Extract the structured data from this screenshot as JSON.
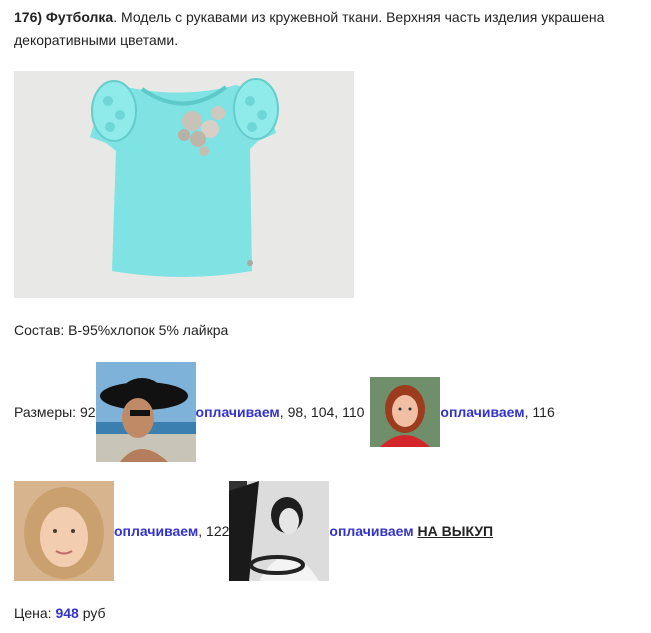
{
  "product": {
    "title": "176) Футболка",
    "description": ". Модель с рукавами из кружевной ткани. Верхняя часть изделия украшена декоративными цветами."
  },
  "composition": "Состав: В-95%хлопок 5% лайкра",
  "sizes": {
    "label": "Размеры: 92",
    "pay_label": "оплачиваем",
    "after_1": ", 98, 104, 110",
    "after_2": ", 116",
    "after_3": ", 122",
    "buyout_label": "НА ВЫКУП"
  },
  "price": {
    "label": "Цена: ",
    "value": "948",
    "currency": " руб"
  },
  "colors": {
    "link": "#3333cc",
    "shirt": "#7fe3e3"
  }
}
